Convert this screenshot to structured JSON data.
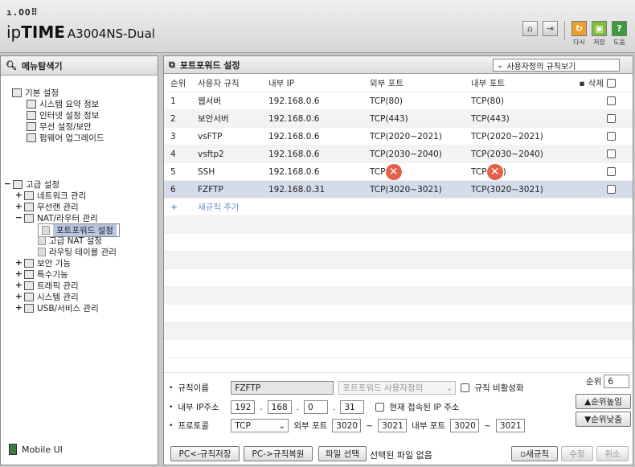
{
  "header": {
    "dots": "ı.OO⠿",
    "brand_a": "ip",
    "brand_b": "TIME",
    "model": "A3004NS-Dual",
    "buttons": [
      {
        "label": "다시",
        "color": "#e8a12a",
        "icon": "refresh-icon"
      },
      {
        "label": "저장",
        "color": "#7fbf3a",
        "icon": "save-icon"
      },
      {
        "label": "도움",
        "color": "#3f9a3f",
        "icon": "help-icon"
      }
    ]
  },
  "sidebar": {
    "title": "메뉴탐색기",
    "basic": {
      "label": "기본 설정",
      "items": [
        "시스템 요약 정보",
        "인터넷 설정 정보",
        "무선 설정/보안",
        "펌웨어 업그레이드"
      ]
    },
    "advanced": {
      "label": "고급 설정",
      "items": [
        "네트워크 관리",
        "무선랜 관리",
        "NAT/라우터 관리"
      ],
      "nat_children": [
        "포트포워드 설정",
        "고급 NAT 설정",
        "라우팅 테이블 관리"
      ],
      "rest": [
        "보안 기능",
        "특수기능",
        "트래픽 관리",
        "시스템 관리",
        "USB/서비스 관리"
      ]
    },
    "mobile": "Mobile UI"
  },
  "main": {
    "title": "포트포워드 설정",
    "view_select": "사용자정의 규칙보기",
    "columns": [
      "순위",
      "사용자 규칙",
      "내부 IP",
      "외부 포트",
      "내부 포트",
      "삭제"
    ],
    "rows": [
      {
        "n": "1",
        "name": "웹서버",
        "ip": "192.168.0.6",
        "ext": "TCP(80)",
        "int": "TCP(80)"
      },
      {
        "n": "2",
        "name": "보안서버",
        "ip": "192.168.0.6",
        "ext": "TCP(443)",
        "int": "TCP(443)"
      },
      {
        "n": "3",
        "name": "vsFTP",
        "ip": "192.168.0.6",
        "ext": "TCP(2020~2021)",
        "int": "TCP(2020~2021)"
      },
      {
        "n": "4",
        "name": "vsftp2",
        "ip": "192.168.0.6",
        "ext": "TCP(2030~2040)",
        "int": "TCP(2030~2040)"
      },
      {
        "n": "5",
        "name": "SSH",
        "ip": "192.168.0.6",
        "ext": "TCP(",
        "int": "TCP(",
        "int_tail": ")"
      },
      {
        "n": "6",
        "name": "FZFTP",
        "ip": "192.168.0.31",
        "ext": "TCP(3020~3021)",
        "int": "TCP(3020~3021)"
      }
    ],
    "add_rule": "새규칙 추가"
  },
  "form": {
    "rule_name_label": "규칙이름",
    "rule_name": "FZFTP",
    "preset_select": "포트포워드 사용자정의",
    "disable_label": "규칙 비활성화",
    "ip_label": "내부 IP주소",
    "ip": [
      "192",
      "168",
      "0",
      "31"
    ],
    "current_ip_label": "현재 접속된 IP 주소",
    "proto_label": "프로토콜",
    "proto": "TCP",
    "ext_label": "외부 포트",
    "ext_from": "3020",
    "ext_to": "3021",
    "int_label": "내부 포트",
    "int_from": "3020",
    "int_to": "3021",
    "rank_label": "순위",
    "rank": "6",
    "rank_up": "순위높임",
    "rank_down": "순위낮춤",
    "btn_save_pc": "PC<-규칙저장",
    "btn_restore_pc": "PC->규칙복원",
    "btn_file": "파일 선택",
    "file_status": "선택된 파일 없음",
    "btn_new": "새규칙",
    "btn_edit": "수정",
    "btn_cancel": "취소"
  }
}
